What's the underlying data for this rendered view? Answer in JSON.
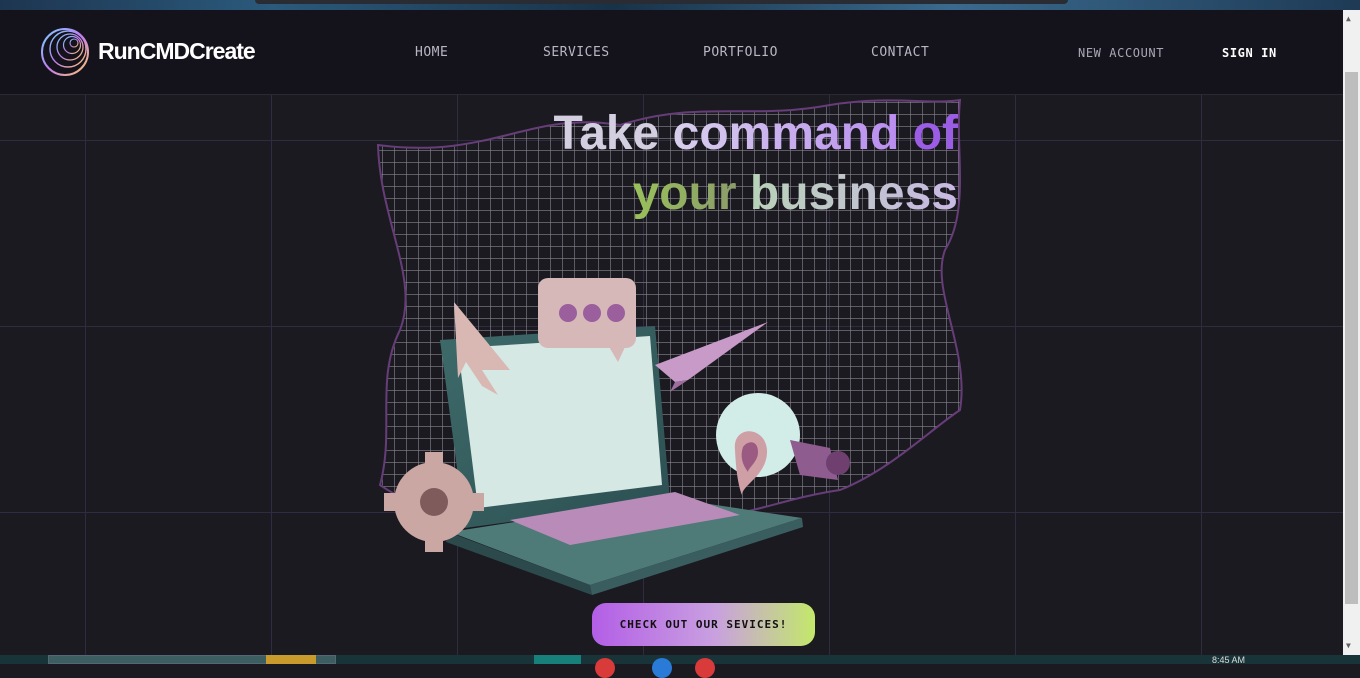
{
  "header": {
    "brand": "RunCMDCreate",
    "nav": [
      "HOME",
      "SERVICES",
      "PORTFOLIO",
      "CONTACT"
    ],
    "new_account": "NEW ACCOUNT",
    "sign_in": "SIGN IN"
  },
  "hero": {
    "line1_a": "Take",
    "line1_b": "command",
    "line1_c": "of",
    "line2_a": "your",
    "line2_b": "business",
    "cta_label": "CHECK OUT OUR SEVICES!"
  },
  "taskbar": {
    "clock": "8:45 AM"
  },
  "colors": {
    "background": "#1b1a20",
    "navbar": "#14131b",
    "accent_purple": "#9b5de6",
    "accent_green": "#9ac15a"
  },
  "icons": [
    "logo-orb-icon",
    "chat-bubble-icon",
    "paper-plane-icon",
    "lightbulb-icon",
    "gear-icon",
    "laptop-icon"
  ]
}
